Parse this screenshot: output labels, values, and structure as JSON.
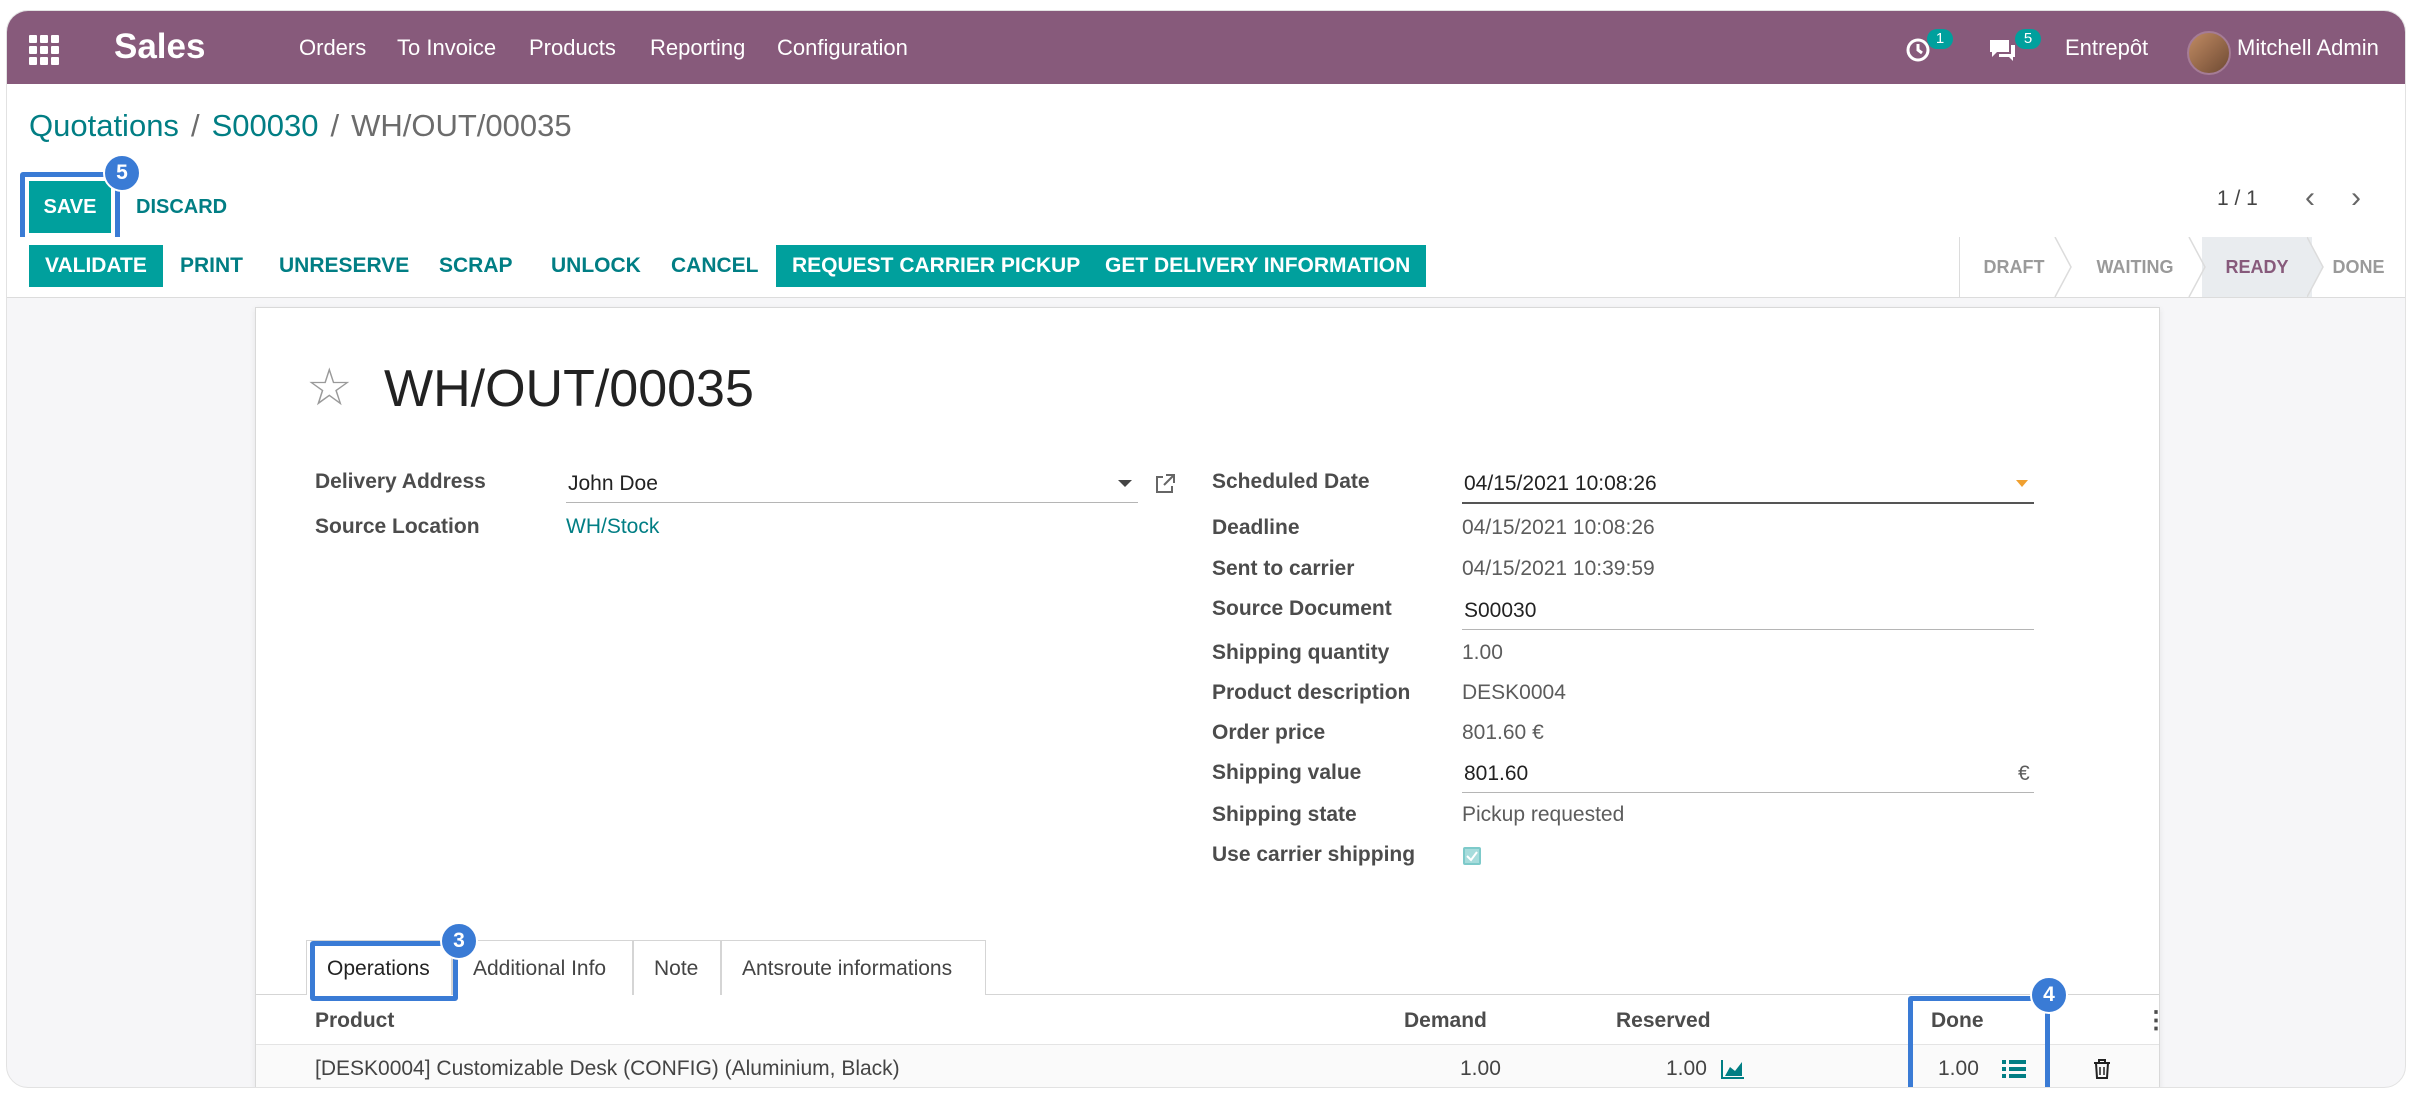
{
  "navbar": {
    "app_title": "Sales",
    "menu": [
      "Orders",
      "To Invoice",
      "Products",
      "Reporting",
      "Configuration"
    ],
    "activity_count": "1",
    "messages_count": "5",
    "company": "Entrepôt",
    "user": "Mitchell Admin",
    "icons": [
      "apps-grid-icon",
      "clock-icon",
      "chat-icon"
    ]
  },
  "breadcrumb": {
    "items": [
      "Quotations",
      "S00030"
    ],
    "current": "WH/OUT/00035",
    "separator": "/"
  },
  "actions": {
    "save": "SAVE",
    "discard": "DISCARD"
  },
  "pager": {
    "value": "1 / 1"
  },
  "statusbar": {
    "buttons": [
      "VALIDATE",
      "PRINT",
      "UNRESERVE",
      "SCRAP",
      "UNLOCK",
      "CANCEL",
      "REQUEST CARRIER PICKUP",
      "GET DELIVERY INFORMATION"
    ],
    "stages": [
      "DRAFT",
      "WAITING",
      "READY",
      "DONE"
    ],
    "active_stage": "READY"
  },
  "record": {
    "title": "WH/OUT/00035",
    "left_fields": {
      "delivery_address_label": "Delivery Address",
      "delivery_address_value": "John Doe",
      "source_location_label": "Source Location",
      "source_location_value": "WH/Stock"
    },
    "right_fields": {
      "scheduled_date_label": "Scheduled Date",
      "scheduled_date_value": "04/15/2021 10:08:26",
      "deadline_label": "Deadline",
      "deadline_value": "04/15/2021 10:08:26",
      "sent_to_carrier_label": "Sent to carrier",
      "sent_to_carrier_value": "04/15/2021 10:39:59",
      "source_document_label": "Source Document",
      "source_document_value": "S00030",
      "shipping_quantity_label": "Shipping quantity",
      "shipping_quantity_value": "1.00",
      "product_description_label": "Product description",
      "product_description_value": "DESK0004",
      "order_price_label": "Order price",
      "order_price_value": "801.60 €",
      "shipping_value_label": "Shipping value",
      "shipping_value_value": "801.60",
      "shipping_value_currency": "€",
      "shipping_state_label": "Shipping state",
      "shipping_state_value": "Pickup requested",
      "use_carrier_shipping_label": "Use carrier shipping",
      "use_carrier_shipping_checked": true
    }
  },
  "tabs": [
    "Operations",
    "Additional Info",
    "Note",
    "Antsroute informations"
  ],
  "active_tab": "Operations",
  "operations_table": {
    "columns": [
      "Product",
      "Demand",
      "Reserved",
      "Done"
    ],
    "rows": [
      {
        "product": "[DESK0004] Customizable Desk (CONFIG) (Aluminium, Black)",
        "demand": "1.00",
        "reserved": "1.00",
        "done": "1.00"
      }
    ]
  },
  "annotations": {
    "save_step": "5",
    "operations_step": "3",
    "done_step": "4",
    "highlight_color": "#3a7bd5"
  },
  "colors": {
    "navbar": "#875a7b",
    "primary": "#00a09d",
    "link": "#017e84"
  }
}
